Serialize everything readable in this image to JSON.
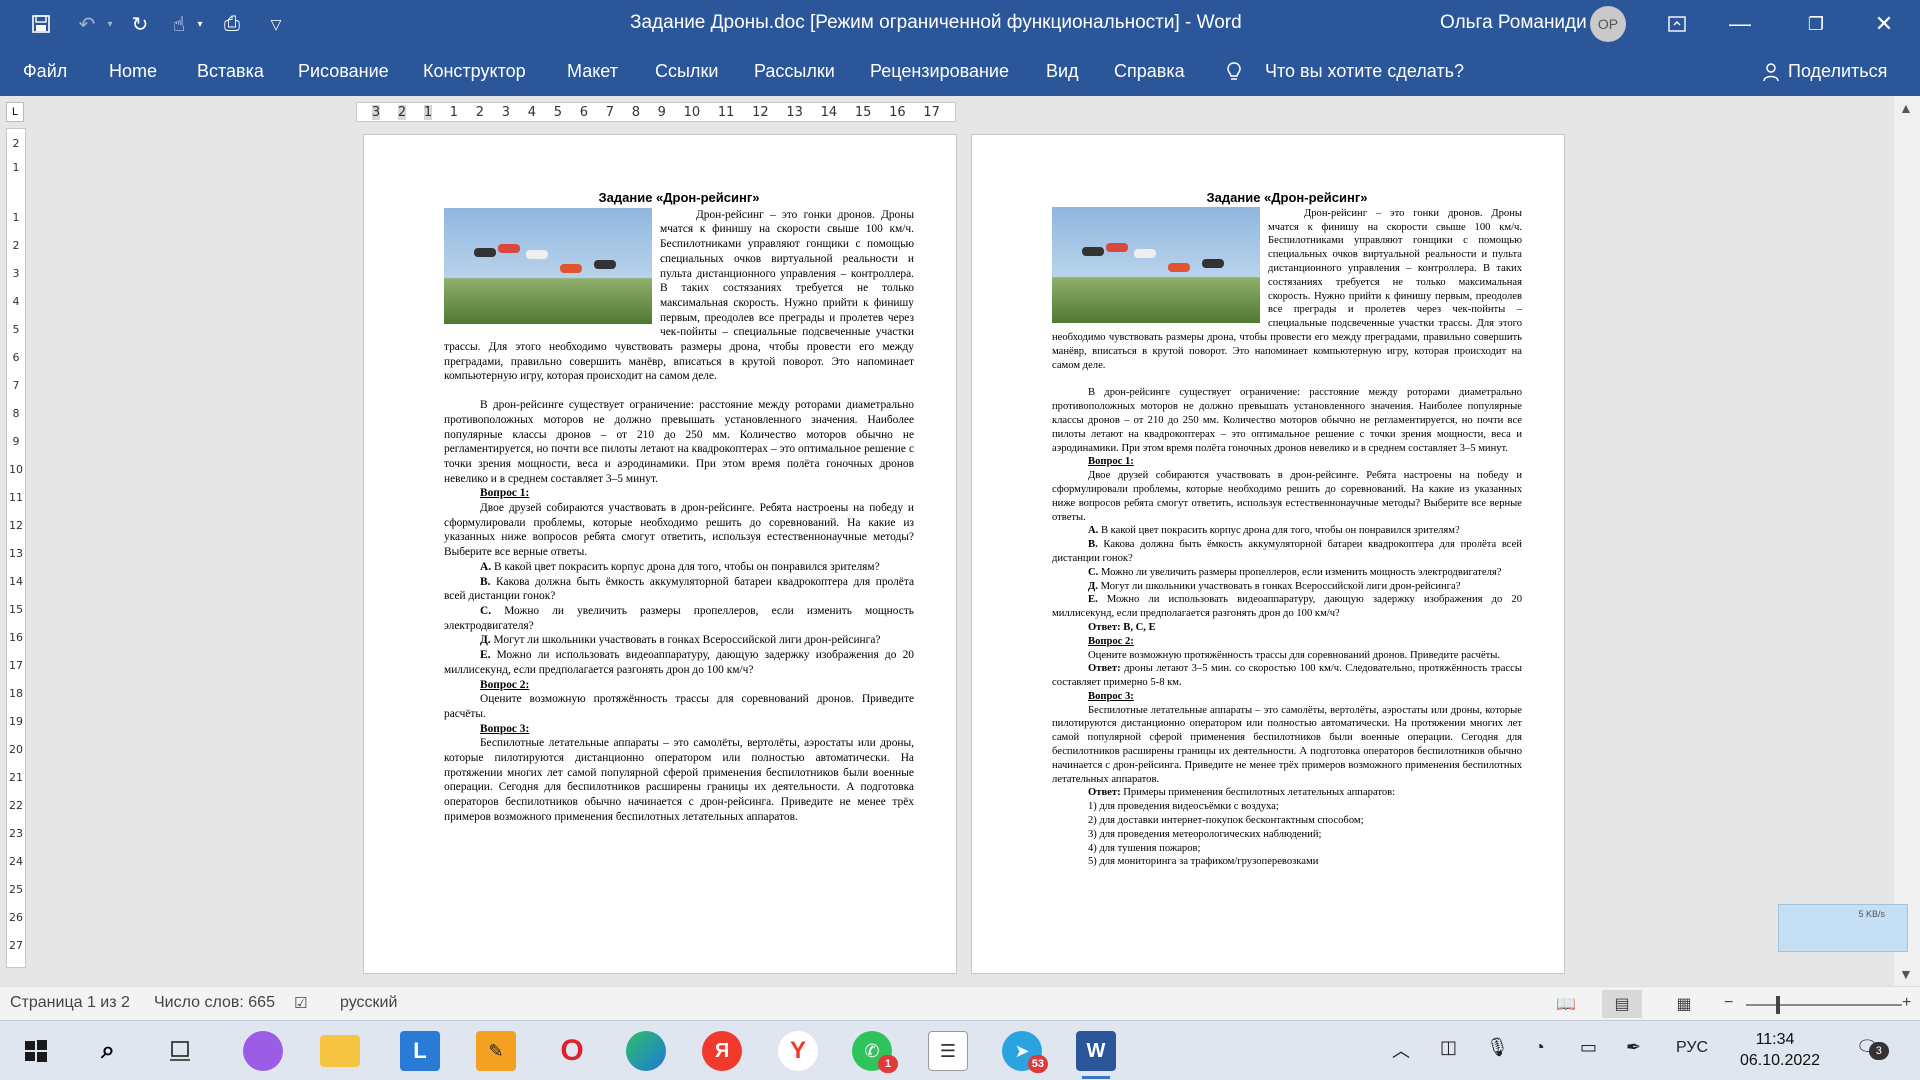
{
  "window": {
    "title": "Задание Дроны.doc [Режим ограниченной функциональности]  -  Word",
    "user_name": "Ольга Романиди",
    "user_initials": "OP"
  },
  "quick_access": {
    "save_icon": "save-icon",
    "undo_icon": "undo-icon",
    "redo_icon": "redo-icon",
    "touch_icon": "touch-mode-icon",
    "print_icon": "print-icon",
    "customize_icon": "customize-icon"
  },
  "menu": {
    "items": [
      "Файл",
      "Home",
      "Вставка",
      "Рисование",
      "Конструктор",
      "Макет",
      "Ссылки",
      "Рассылки",
      "Рецензирование",
      "Вид",
      "Справка"
    ],
    "tell_me": "Что вы хотите сделать?",
    "share": "Поделиться"
  },
  "ruler": {
    "h_left": [
      "3",
      "2",
      "1"
    ],
    "h_right": [
      "1",
      "2",
      "3",
      "4",
      "5",
      "6",
      "7",
      "8",
      "9",
      "10",
      "11",
      "12",
      "13",
      "14",
      "15",
      "16",
      "17"
    ],
    "v": [
      "2",
      "1",
      "1",
      "2",
      "3",
      "4",
      "5",
      "6",
      "7",
      "8",
      "9",
      "10",
      "11",
      "12",
      "13",
      "14",
      "15",
      "16",
      "17",
      "18",
      "19",
      "20",
      "21",
      "22",
      "23",
      "24",
      "25",
      "26",
      "27"
    ]
  },
  "page1": {
    "title": "Задание «Дрон-рейсинг»",
    "p1": "Дрон-рейсинг – это гонки дронов. Дроны мчатся к финишу на скорости свыше 100 км/ч. Беспилотниками управляют гонщики с помощью специальных очков виртуальной реальности и пульта дистанционного управления – контроллера. В таких состязаниях требуется не только максимальная скорость. Нужно прийти к финишу первым, преодолев все преграды и пролетев через чек-пойнты – специальные подсвеченные участки трассы. Для этого необходимо чувствовать размеры дрона, чтобы провести его между преградами, правильно совершить манёвр, вписаться в крутой поворот. Это напоминает компьютерную игру, которая происходит на самом деле.",
    "p2": "В дрон-рейсинге существует ограничение: расстояние между роторами диаметрально противоположных моторов не должно превышать установленного значения. Наиболее популярные классы дронов – от 210 до 250 мм. Количество моторов обычно не регламентируется, но почти все пилоты летают на квадрокоптерах – это оптимальное решение с точки зрения мощности, веса и аэродинамики. При этом время полёта гоночных дронов невелико и в среднем составляет 3–5 минут.",
    "q1_head": "Вопрос 1:",
    "q1_text": "Двое друзей собираются участвовать в дрон-рейсинге. Ребята настроены на победу и сформулировали проблемы, которые необходимо решить до соревнований. На какие из указанных ниже вопросов ребята смогут ответить, используя естественнонаучные методы? Выберите все верные ответы.",
    "opts": [
      {
        "k": "А.",
        "t": "В какой цвет покрасить корпус дрона для того, чтобы он понравился зрителям?"
      },
      {
        "k": "В.",
        "t": "Какова должна быть ёмкость аккумуляторной батареи квадрокоптера для пролёта всей дистанции гонок?"
      },
      {
        "k": "С.",
        "t": "Можно ли увеличить размеры пропеллеров, если изменить мощность электродвигателя?"
      },
      {
        "k": "Д.",
        "t": "Могут ли школьники участвовать в гонках Всероссийской лиги дрон-рейсинга?"
      },
      {
        "k": "Е.",
        "t": "Можно ли использовать видеоаппаратуру, дающую задержку изображения до 20 миллисекунд, если предполагается разгонять дрон до 100 км/ч?"
      }
    ],
    "q2_head": "Вопрос 2:",
    "q2_text": "Оцените возможную протяжённость трассы для соревнований дронов. Приведите расчёты.",
    "q3_head": "Вопрос 3:",
    "q3_text": "Беспилотные летательные аппараты – это самолёты, вертолёты, аэростаты или дроны, которые пилотируются дистанционно оператором или полностью автоматически. На протяжении многих лет самой популярной сферой применения беспилотников были военные операции. Сегодня для беспилотников расширены границы их деятельности. А подготовка операторов беспилотников обычно начинается с дрон-рейсинга. Приведите не менее трёх примеров возможного применения беспилотных летательных аппаратов."
  },
  "page2": {
    "title": "Задание «Дрон-рейсинг»",
    "p1": "Дрон-рейсинг – это гонки дронов. Дроны мчатся к финишу на скорости свыше 100 км/ч. Беспилотниками управляют гонщики с помощью специальных очков виртуальной реальности и пульта дистанционного управления – контроллера. В таких состязаниях требуется не только максимальная скорость. Нужно прийти к финишу первым, преодолев все преграды и пролетев через чек-пойнты – специальные подсвеченные участки трассы. Для этого необходимо чувствовать размеры дрона, чтобы провести его между преградами, правильно совершить манёвр, вписаться в крутой поворот. Это напоминает компьютерную игру, которая происходит на самом деле.",
    "p2": "В дрон-рейсинге существует ограничение: расстояние между роторами диаметрально противоположных моторов не должно превышать установленного значения. Наиболее популярные классы дронов – от 210 до 250 мм. Количество моторов обычно не регламентируется, но почти все пилоты летают на квадрокоптерах – это оптимальное решение с точки зрения мощности, веса и аэродинамики. При этом время полёта гоночных дронов невелико и в среднем составляет 3–5 минут.",
    "q1_head": "Вопрос 1:",
    "q1_text": "Двое друзей собираются участвовать в дрон-рейсинге. Ребята настроены на победу и сформулировали проблемы, которые необходимо решить до соревнований. На какие из указанных ниже вопросов ребята смогут ответить, используя естественнонаучные методы? Выберите все верные ответы.",
    "opts": [
      {
        "k": "А.",
        "t": "В какой цвет покрасить корпус дрона для того, чтобы он понравился зрителям?"
      },
      {
        "k": "В.",
        "t": "Какова должна быть ёмкость аккумуляторной батареи квадрокоптера для пролёта всей дистанции гонок?"
      },
      {
        "k": "С.",
        "t": "Можно ли увеличить размеры пропеллеров, если изменить мощность электродвигателя?"
      },
      {
        "k": "Д.",
        "t": "Могут ли школьники участвовать в гонках Всероссийской лиги дрон-рейсинга?"
      },
      {
        "k": "Е.",
        "t": "Можно ли использовать видеоаппаратуру, дающую задержку изображения до 20 миллисекунд, если предполагается разгонять дрон до 100 км/ч?"
      }
    ],
    "a1_label": "Ответ:",
    "a1_value": "В, С, Е",
    "q2_head": "Вопрос 2:",
    "q2_text": "Оцените возможную протяжённость трассы для соревнований дронов. Приведите расчёты.",
    "a2_label": "Ответ:",
    "a2_text": "дроны летают 3–5 мин. со скоростью 100 км/ч. Следовательно, протяжённость трассы составляет примерно 5-8 км.",
    "q3_head": "Вопрос 3:",
    "q3_text": "Беспилотные летательные аппараты – это самолёты, вертолёты, аэростаты или дроны, которые пилотируются дистанционно оператором или полностью автоматически. На протяжении многих лет самой популярной сферой применения беспилотников были военные операции. Сегодня для беспилотников расширены границы их деятельности. А подготовка операторов беспилотников обычно начинается с дрон-рейсинга. Приведите не менее трёх примеров возможного применения беспилотных летательных аппаратов.",
    "a3_label": "Ответ:",
    "a3_text": "Примеры применения беспилотных летательных аппаратов:",
    "a3_list": [
      "1)  для проведения видеосъёмки с воздуха;",
      "2)  для доставки интернет-покупок бесконтактным способом;",
      "3)  для проведения метеорологических наблюдений;",
      "4)  для тушения пожаров;",
      "5)  для мониторинга за трафиком/грузоперевозками"
    ]
  },
  "status": {
    "page": "Страница 1 из 2",
    "words": "Число слов: 665",
    "language": "русский"
  },
  "popup": {
    "speed": "5 KB/s"
  },
  "taskbar": {
    "whatsapp_badge": "1",
    "telegram_badge": "53",
    "language": "РУС",
    "time": "11:34",
    "date": "06.10.2022",
    "notifications": "3"
  }
}
